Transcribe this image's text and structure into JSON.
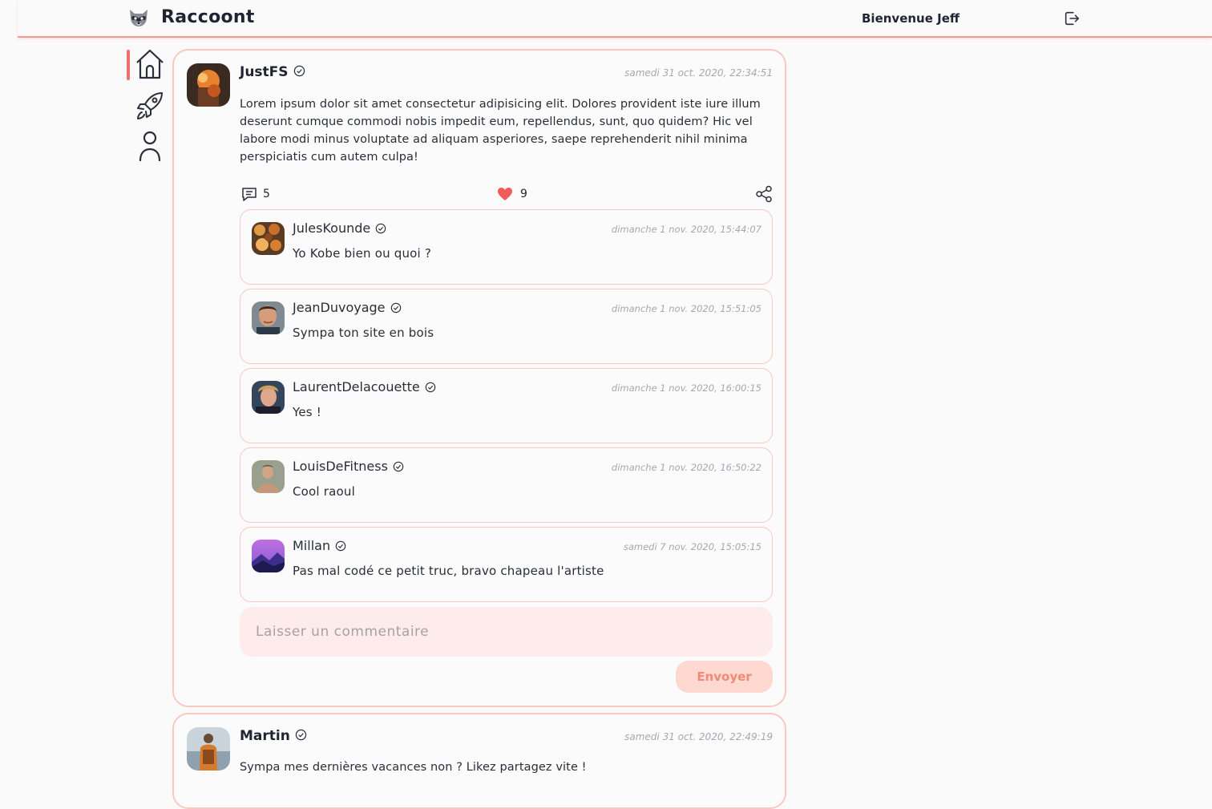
{
  "header": {
    "app_title": "Raccoont",
    "logo_icon": "raccoon-logo-icon",
    "welcome": "Bienvenue Jeff",
    "logout_icon": "logout-icon"
  },
  "sidebar": {
    "items": [
      {
        "icon": "home-icon",
        "active": true
      },
      {
        "icon": "rocket-icon",
        "active": false
      },
      {
        "icon": "user-icon",
        "active": false
      }
    ],
    "active_color": "#f0716b"
  },
  "posts": [
    {
      "author": "JustFS",
      "date": "samedi 31 oct. 2020, 22:34:51",
      "text": "Lorem ipsum dolor sit amet consectetur adipisicing elit. Dolores provident iste iure illum deserunt cumque commodi nobis impedit eum, repellendus, sunt, quo quidem? Hic vel labore modi minus voluptate ad aliquam asperiores, saepe reprehenderit nihil minima perspiciatis cum autem culpa!",
      "comment_count": "5",
      "like_count": "9",
      "comments": [
        {
          "author": "JulesKounde",
          "date": "dimanche 1 nov. 2020, 15:44:07",
          "text": "Yo Kobe bien ou quoi ?"
        },
        {
          "author": "JeanDuvoyage",
          "date": "dimanche 1 nov. 2020, 15:51:05",
          "text": "Sympa ton site en bois"
        },
        {
          "author": "LaurentDelacouette",
          "date": "dimanche 1 nov. 2020, 16:00:15",
          "text": "Yes !"
        },
        {
          "author": "LouisDeFitness",
          "date": "dimanche 1 nov. 2020, 16:50:22",
          "text": "Cool raoul"
        },
        {
          "author": "Millan",
          "date": "samedi 7 nov. 2020, 15:05:15",
          "text": "Pas mal codé ce petit truc, bravo chapeau l'artiste"
        }
      ],
      "comment_placeholder": "Laisser un commentaire",
      "send_label": "Envoyer"
    },
    {
      "author": "Martin",
      "date": "samedi 31 oct. 2020, 22:49:19",
      "text": "Sympa mes dernières vacances non ? Likez partagez vite !"
    }
  ],
  "colors": {
    "accent": "#f0716b",
    "card_border": "#f8c9c2",
    "input_bg": "#fdeceb",
    "button_bg": "#fdd9d1",
    "button_text": "#f08a75",
    "heart": "#f05a5a"
  }
}
